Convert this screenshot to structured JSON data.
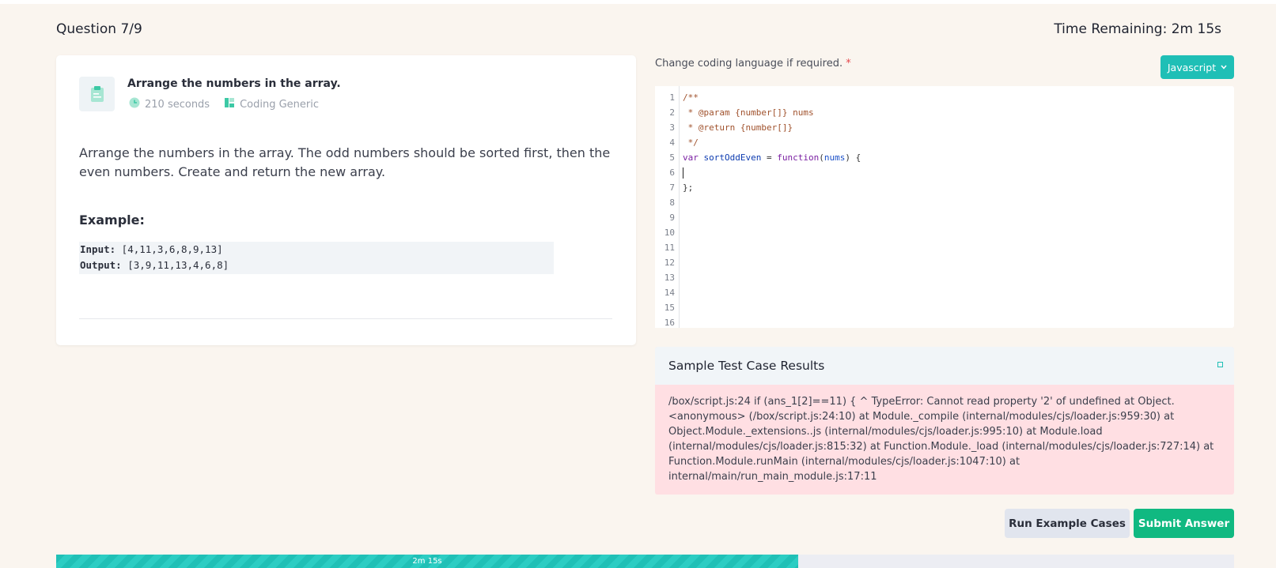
{
  "header": {
    "question_counter": "Question 7/9",
    "time_remaining": "Time Remaining: 2m 15s"
  },
  "question": {
    "title": "Arrange the numbers in the array.",
    "duration": "210 seconds",
    "category": "Coding Generic",
    "description": "Arrange the numbers in the array. The odd numbers should be sorted first, then the even numbers. Create and return the new array.",
    "example_heading": "Example:",
    "example": {
      "input_label": "Input:",
      "input_value": " [4,11,3,6,8,9,13]",
      "output_label": "Output:",
      "output_value": " [3,9,11,13,4,6,8]"
    }
  },
  "editor": {
    "language_label": "Change coding language if required.",
    "required_mark": "*",
    "language": "Javascript",
    "line_numbers": [
      "1",
      "2",
      "3",
      "4",
      "5",
      "6",
      "7",
      "8",
      "9",
      "10",
      "11",
      "12",
      "13",
      "14",
      "15",
      "16"
    ],
    "code": {
      "l1": "/**",
      "l2": " * @param {number[]} nums",
      "l3": " * @return {number[]}",
      "l4": " */",
      "l5_kw": "var",
      "l5_def": "sortOddEven",
      "l5_eq": " = ",
      "l5_fn": "function",
      "l5_open": "(",
      "l5_param": "nums",
      "l5_close": ") {",
      "l7": "};"
    }
  },
  "results": {
    "heading": "Sample Test Case Results",
    "message": "/box/script.js:24 if (ans_1[2]==11) { ^ TypeError: Cannot read property '2' of undefined at Object.<anonymous> (/box/script.js:24:10) at Module._compile (internal/modules/cjs/loader.js:959:30) at Object.Module._extensions..js (internal/modules/cjs/loader.js:995:10) at Module.load (internal/modules/cjs/loader.js:815:32) at Function.Module._load (internal/modules/cjs/loader.js:727:14) at Function.Module.runMain (internal/modules/cjs/loader.js:1047:10) at internal/main/run_main_module.js:17:11"
  },
  "actions": {
    "run_label": "Run Example Cases",
    "submit_label": "Submit Answer"
  },
  "progress": {
    "label": "2m 15s",
    "fraction": 0.63
  },
  "colors": {
    "accent": "#1fbfb6",
    "submit": "#10b981",
    "error_bg": "#ffdfe3"
  }
}
